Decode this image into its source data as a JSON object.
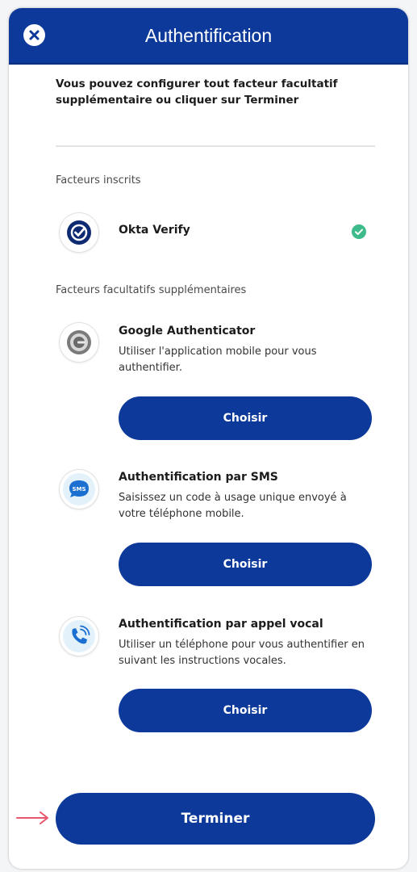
{
  "header": {
    "title": "Authentification",
    "close_icon": "close-icon"
  },
  "intro_text": "Vous pouvez configurer tout facteur facultatif supplémentaire ou cliquer sur Terminer",
  "enrolled": {
    "label": "Facteurs inscrits",
    "factors": [
      {
        "title": "Okta Verify",
        "icon": "okta-verify-icon",
        "status_icon": "check-circle-icon"
      }
    ]
  },
  "optional": {
    "label": "Facteurs facultatifs supplémentaires",
    "factors": [
      {
        "title": "Google Authenticator",
        "description": "Utiliser l'application mobile pour vous authentifier.",
        "icon": "google-authenticator-icon",
        "button_label": "Choisir"
      },
      {
        "title": "Authentification par SMS",
        "description": "Saisissez un code à usage unique envoyé à votre téléphone mobile.",
        "icon": "sms-icon",
        "icon_text": "SMS",
        "button_label": "Choisir"
      },
      {
        "title": "Authentification par appel vocal",
        "description": "Utiliser un téléphone pour vous authentifier en suivant les instructions vocales.",
        "icon": "phone-call-icon",
        "button_label": "Choisir"
      }
    ]
  },
  "finish_label": "Terminer",
  "colors": {
    "primary": "#0d3a9a",
    "success": "#3dbb8a",
    "annotation_arrow": "#e8566c"
  }
}
